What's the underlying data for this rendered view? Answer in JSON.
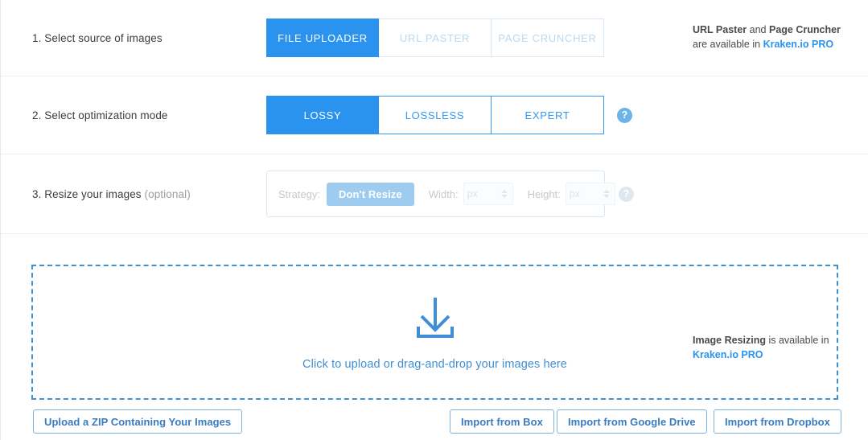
{
  "rows": [
    {
      "label_prefix": "1. Select source of images",
      "options": [
        {
          "label": "FILE UPLOADER",
          "active": true
        },
        {
          "label": "URL PASTER",
          "active": false
        },
        {
          "label": "PAGE CRUNCHER",
          "active": false
        }
      ],
      "note_line1_bold": "URL Paster",
      "note_line1_rest": " and ",
      "note_line1_bold2": "Page Cruncher",
      "note_line2_rest": "are available in ",
      "note_link": "Kraken.io PRO"
    },
    {
      "label_prefix": "2. Select optimization mode",
      "options": [
        {
          "label": "LOSSY",
          "active": true
        },
        {
          "label": "LOSSLESS",
          "active": false
        },
        {
          "label": "EXPERT",
          "active": false
        }
      ],
      "help_icon": "question-mark-icon"
    },
    {
      "label_prefix": "3. Resize your images",
      "label_optional": "(optional)",
      "strategy_label": "Strategy:",
      "strategy_value": "Don't Resize",
      "width_label": "Width:",
      "width_placeholder": "px",
      "height_label": "Height:",
      "height_placeholder": "px",
      "help_icon": "question-mark-icon",
      "note_line1_bold": "Image Resizing",
      "note_line1_rest": " is available in",
      "note_link": "Kraken.io PRO"
    }
  ],
  "dropzone": {
    "icon": "download-arrow-icon",
    "text": "Click to upload or drag-and-drop your images here"
  },
  "actions": {
    "zip": "Upload a ZIP Containing Your Images",
    "box": "Import from Box",
    "google_drive": "Import from Google Drive",
    "dropbox": "Import from Dropbox"
  },
  "colors": {
    "accent": "#2a93f0",
    "link": "#2a93f0",
    "dropzone_border": "#3f92d2",
    "muted_blue": "#bcd9ef",
    "strategy_chip": "#9ecbf0"
  }
}
